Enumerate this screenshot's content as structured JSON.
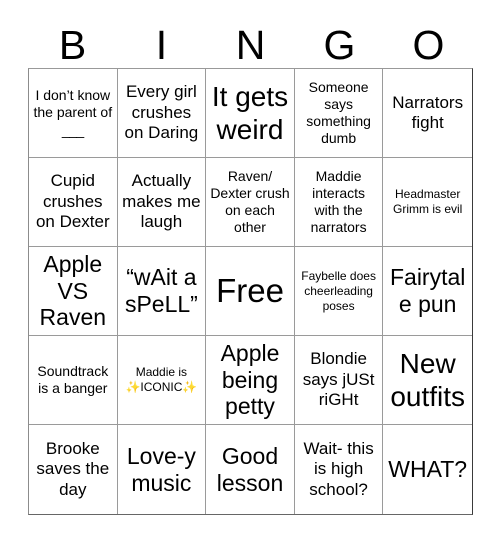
{
  "header": {
    "letters": [
      "B",
      "I",
      "N",
      "G",
      "O"
    ]
  },
  "grid": {
    "rows": 5,
    "columns": 5,
    "border_color": "#9a9a9a",
    "background_color": "#ffffff",
    "text_color": "#000000",
    "sparkle_color": "#f5b914"
  },
  "cells": [
    {
      "id": "b1",
      "column": "B",
      "row": 1,
      "text": "I don’t know the parent of",
      "blank": "___",
      "size": "sm",
      "free": false
    },
    {
      "id": "i1",
      "column": "I",
      "row": 1,
      "text": "Every girl crushes on Daring",
      "size": "md",
      "free": false
    },
    {
      "id": "n1",
      "column": "N",
      "row": 1,
      "text": "It gets weird",
      "size": "xl",
      "free": false
    },
    {
      "id": "g1",
      "column": "G",
      "row": 1,
      "text": "Someone says something dumb",
      "size": "sm",
      "free": false
    },
    {
      "id": "o1",
      "column": "O",
      "row": 1,
      "text": "Narrators fight",
      "size": "md",
      "free": false
    },
    {
      "id": "b2",
      "column": "B",
      "row": 2,
      "text": "Cupid crushes on Dexter",
      "size": "md",
      "free": false
    },
    {
      "id": "i2",
      "column": "I",
      "row": 2,
      "text": "Actually makes me laugh",
      "size": "md",
      "free": false
    },
    {
      "id": "n2",
      "column": "N",
      "row": 2,
      "text": "Raven/ Dexter crush on each other",
      "size": "sm",
      "free": false
    },
    {
      "id": "g2",
      "column": "G",
      "row": 2,
      "text": "Maddie interacts with the narrators",
      "size": "sm",
      "free": false
    },
    {
      "id": "o2",
      "column": "O",
      "row": 2,
      "text": "Headmaster Grimm is evil",
      "size": "xs",
      "free": false
    },
    {
      "id": "b3",
      "column": "B",
      "row": 3,
      "text": "Apple VS Raven",
      "size": "lg",
      "free": false
    },
    {
      "id": "i3",
      "column": "I",
      "row": 3,
      "text": "“wAit a sPeLL”",
      "size": "lg",
      "free": false
    },
    {
      "id": "n3",
      "column": "N",
      "row": 3,
      "text": "Free",
      "size": "free",
      "free": true
    },
    {
      "id": "g3",
      "column": "G",
      "row": 3,
      "text": "Faybelle does cheerleading poses",
      "size": "xs",
      "free": false
    },
    {
      "id": "o3",
      "column": "O",
      "row": 3,
      "text": "Fairytale pun",
      "size": "lg",
      "free": false
    },
    {
      "id": "b4",
      "column": "B",
      "row": 4,
      "text": "Soundtrack is a banger",
      "size": "sm",
      "free": false
    },
    {
      "id": "i4",
      "column": "I",
      "row": 4,
      "text": "Maddie is",
      "sparkle_text": "ICONIC",
      "sparkle": "✨",
      "size": "xs",
      "free": false
    },
    {
      "id": "n4",
      "column": "N",
      "row": 4,
      "text": "Apple being petty",
      "size": "lg",
      "free": false
    },
    {
      "id": "g4",
      "column": "G",
      "row": 4,
      "text": "Blondie says jUSt riGHt",
      "size": "md",
      "free": false
    },
    {
      "id": "o4",
      "column": "O",
      "row": 4,
      "text": "New outfits",
      "size": "xl",
      "free": false
    },
    {
      "id": "b5",
      "column": "B",
      "row": 5,
      "text": "Brooke saves the day",
      "size": "md",
      "free": false
    },
    {
      "id": "i5",
      "column": "I",
      "row": 5,
      "text": "Love-y music",
      "size": "lg",
      "free": false
    },
    {
      "id": "n5",
      "column": "N",
      "row": 5,
      "text": "Good lesson",
      "size": "lg",
      "free": false
    },
    {
      "id": "g5",
      "column": "G",
      "row": 5,
      "text": "Wait- this is high school?",
      "size": "md",
      "free": false
    },
    {
      "id": "o5",
      "column": "O",
      "row": 5,
      "text": "WHAT?",
      "size": "lg",
      "free": false
    }
  ]
}
